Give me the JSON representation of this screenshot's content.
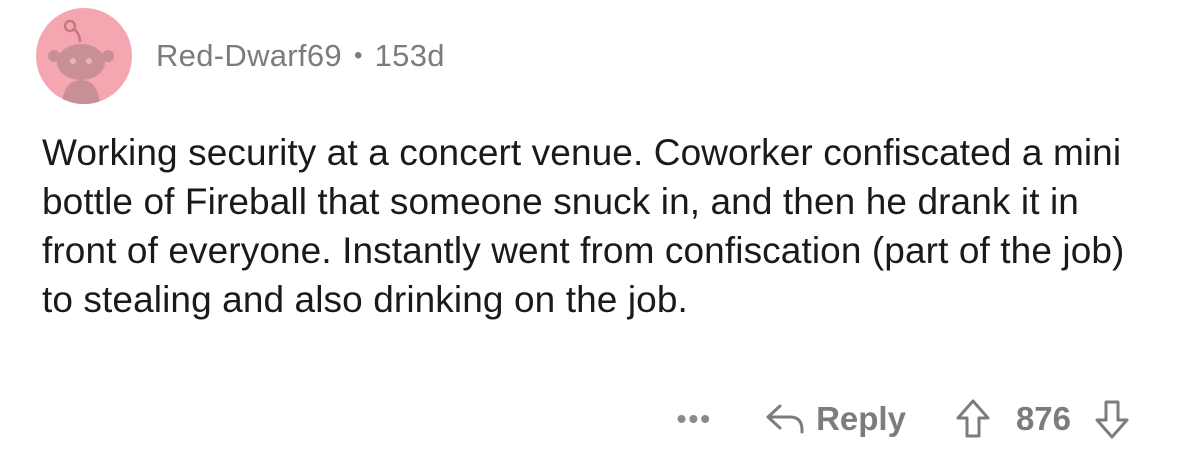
{
  "comment": {
    "username": "Red-Dwarf69",
    "separator": "•",
    "age": "153d",
    "avatar": {
      "icon": "reddit-snoo-icon",
      "background": "#f4a6b1"
    },
    "body": "Working security at a concert venue. Coworker confiscated a mini bottle of Fireball that someone snuck in, and then he drank it in front of everyone. Instantly went from confiscation (part of the job) to stealing and also drinking on the job.",
    "actions": {
      "more_label": "•••",
      "reply_label": "Reply",
      "score": "876"
    }
  }
}
